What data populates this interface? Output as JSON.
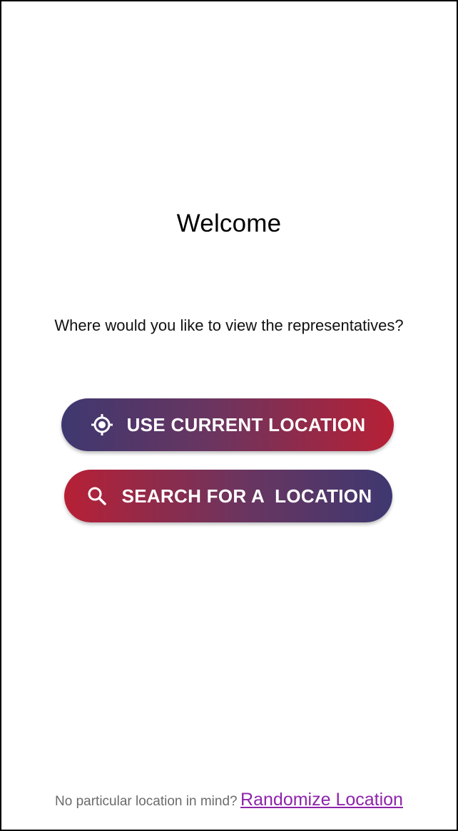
{
  "welcome": {
    "title": "Welcome",
    "prompt": "Where would you like to view the representatives?"
  },
  "actions": {
    "current_location": {
      "label": "USE CURRENT LOCATION",
      "icon": "crosshair-location-icon"
    },
    "search_location": {
      "label": "SEARCH FOR A  LOCATION",
      "icon": "search-icon"
    }
  },
  "footer": {
    "prefix": "No particular location in mind?",
    "link": "Randomize Location"
  },
  "colors": {
    "button_blue": "#3e3870",
    "button_red": "#b72035",
    "link_purple": "#8e24aa",
    "muted_text": "#6b6b6b"
  }
}
